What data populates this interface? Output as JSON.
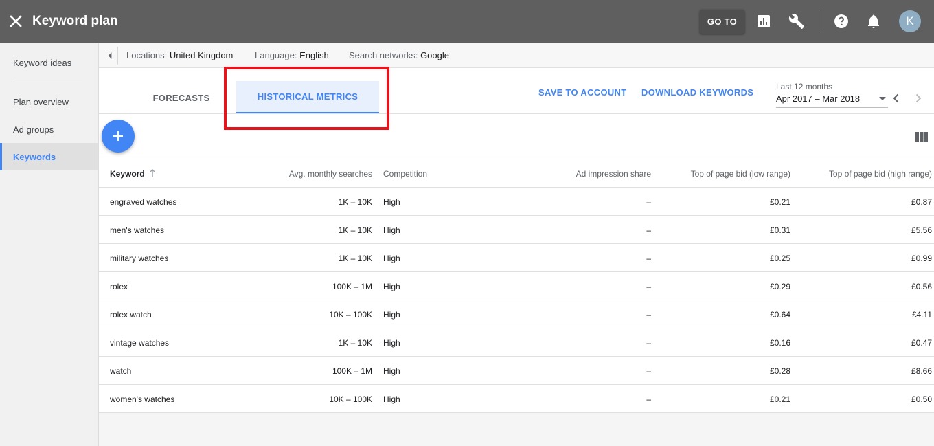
{
  "topbar": {
    "title": "Keyword plan",
    "goto_label": "GO TO",
    "avatar_letter": "K",
    "icons": [
      "close-icon",
      "reports-icon",
      "wrench-icon",
      "help-icon",
      "bell-icon"
    ],
    "background": "#5f5f5f"
  },
  "sidebar": {
    "items": [
      {
        "label": "Keyword ideas"
      },
      {
        "label": "Plan overview"
      },
      {
        "label": "Ad groups"
      },
      {
        "label": "Keywords",
        "active": true
      }
    ]
  },
  "filters": {
    "locations_label": "Locations:",
    "locations_value": "United Kingdom",
    "language_label": "Language:",
    "language_value": "English",
    "networks_label": "Search networks:",
    "networks_value": "Google"
  },
  "tabs": {
    "forecasts": "FORECASTS",
    "historical": "HISTORICAL METRICS",
    "active": "historical"
  },
  "actions": {
    "save": "SAVE TO ACCOUNT",
    "download": "DOWNLOAD KEYWORDS"
  },
  "date_range": {
    "caption": "Last 12 months",
    "value": "Apr 2017 – Mar 2018"
  },
  "table": {
    "headers": {
      "keyword": "Keyword",
      "avg": "Avg. monthly searches",
      "competition": "Competition",
      "ais": "Ad impression share",
      "low": "Top of page bid (low range)",
      "high": "Top of page bid (high range)"
    },
    "rows": [
      {
        "keyword": "engraved watches",
        "avg": "1K – 10K",
        "competition": "High",
        "ais": "–",
        "low": "£0.21",
        "high": "£0.87"
      },
      {
        "keyword": "men's watches",
        "avg": "1K – 10K",
        "competition": "High",
        "ais": "–",
        "low": "£0.31",
        "high": "£5.56"
      },
      {
        "keyword": "military watches",
        "avg": "1K – 10K",
        "competition": "High",
        "ais": "–",
        "low": "£0.25",
        "high": "£0.99"
      },
      {
        "keyword": "rolex",
        "avg": "100K – 1M",
        "competition": "High",
        "ais": "–",
        "low": "£0.29",
        "high": "£0.56"
      },
      {
        "keyword": "rolex watch",
        "avg": "10K – 100K",
        "competition": "High",
        "ais": "–",
        "low": "£0.64",
        "high": "£4.11"
      },
      {
        "keyword": "vintage watches",
        "avg": "1K – 10K",
        "competition": "High",
        "ais": "–",
        "low": "£0.16",
        "high": "£0.47"
      },
      {
        "keyword": "watch",
        "avg": "100K – 1M",
        "competition": "High",
        "ais": "–",
        "low": "£0.28",
        "high": "£8.66"
      },
      {
        "keyword": "women's watches",
        "avg": "10K – 100K",
        "competition": "High",
        "ais": "–",
        "low": "£0.21",
        "high": "£0.50"
      }
    ]
  },
  "colors": {
    "accent": "#4285f4",
    "highlight_box": "#e8121b"
  }
}
